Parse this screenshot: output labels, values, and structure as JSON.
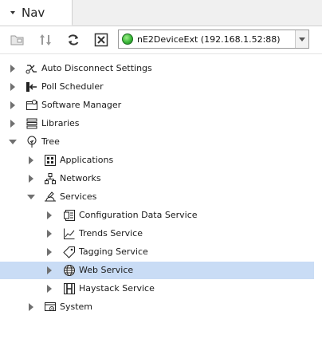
{
  "nav": {
    "title": "Nav"
  },
  "host": {
    "label": "nE2DeviceExt (192.168.1.52:88)",
    "status_color": "#3cb83a"
  },
  "tree": [
    {
      "label": "Auto Disconnect Settings",
      "icon": "auto-disconnect-icon",
      "expanded": false
    },
    {
      "label": "Poll Scheduler",
      "icon": "poll-scheduler-icon",
      "expanded": false
    },
    {
      "label": "Software Manager",
      "icon": "software-manager-icon",
      "expanded": false
    },
    {
      "label": "Libraries",
      "icon": "libraries-icon",
      "expanded": false
    },
    {
      "label": "Tree",
      "icon": "tree-icon",
      "expanded": true
    },
    {
      "label": "Applications",
      "icon": "applications-icon",
      "expanded": false
    },
    {
      "label": "Networks",
      "icon": "networks-icon",
      "expanded": false
    },
    {
      "label": "Services",
      "icon": "services-icon",
      "expanded": true
    },
    {
      "label": "Configuration Data Service",
      "icon": "configuration-data-icon",
      "expanded": false
    },
    {
      "label": "Trends Service",
      "icon": "trends-icon",
      "expanded": false
    },
    {
      "label": "Tagging Service",
      "icon": "tagging-icon",
      "expanded": false
    },
    {
      "label": "Web Service",
      "icon": "web-service-icon",
      "expanded": false,
      "selected": true
    },
    {
      "label": "Haystack Service",
      "icon": "haystack-icon",
      "expanded": false
    },
    {
      "label": "System",
      "icon": "system-icon",
      "expanded": false
    }
  ],
  "colors": {
    "selection": "#c9dcf5"
  }
}
